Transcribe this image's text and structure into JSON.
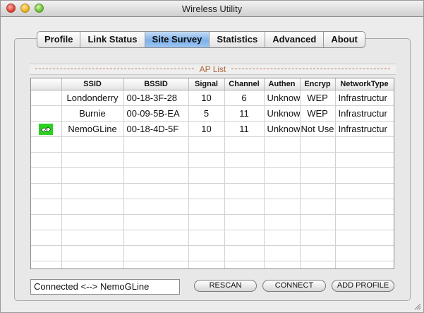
{
  "window": {
    "title": "Wireless Utility"
  },
  "tabs": [
    {
      "label": "Profile",
      "active": false
    },
    {
      "label": "Link Status",
      "active": false
    },
    {
      "label": "Site Survey",
      "active": true
    },
    {
      "label": "Statistics",
      "active": false
    },
    {
      "label": "Advanced",
      "active": false
    },
    {
      "label": "About",
      "active": false
    }
  ],
  "ap_list": {
    "label": "AP List",
    "columns": [
      "",
      "SSID",
      "BSSID",
      "Signal",
      "Channel",
      "Authen",
      "Encryp",
      "NetworkType"
    ],
    "rows": [
      {
        "connected": false,
        "ssid": "Londonderry",
        "bssid": "00-18-3F-28",
        "signal": "10",
        "channel": "6",
        "authen": "Unknow",
        "encryp": "WEP",
        "network_type": "Infrastructur"
      },
      {
        "connected": false,
        "ssid": "Burnie",
        "bssid": "00-09-5B-EA",
        "signal": "5",
        "channel": "11",
        "authen": "Unknow",
        "encryp": "WEP",
        "network_type": "Infrastructur"
      },
      {
        "connected": true,
        "ssid": "NemoGLine",
        "bssid": "00-18-4D-5F",
        "signal": "10",
        "channel": "11",
        "authen": "Unknow",
        "encryp": "Not Use",
        "network_type": "Infrastructur"
      }
    ]
  },
  "status": {
    "text": "Connected <--> NemoGLine"
  },
  "buttons": {
    "rescan": "RESCAN",
    "connect": "CONNECT",
    "add_profile": "ADD PROFILE"
  },
  "colors": {
    "active_tab": "#7fb1ea",
    "connected_icon_bg": "#2bd11f",
    "ap_label": "#b0683a"
  }
}
